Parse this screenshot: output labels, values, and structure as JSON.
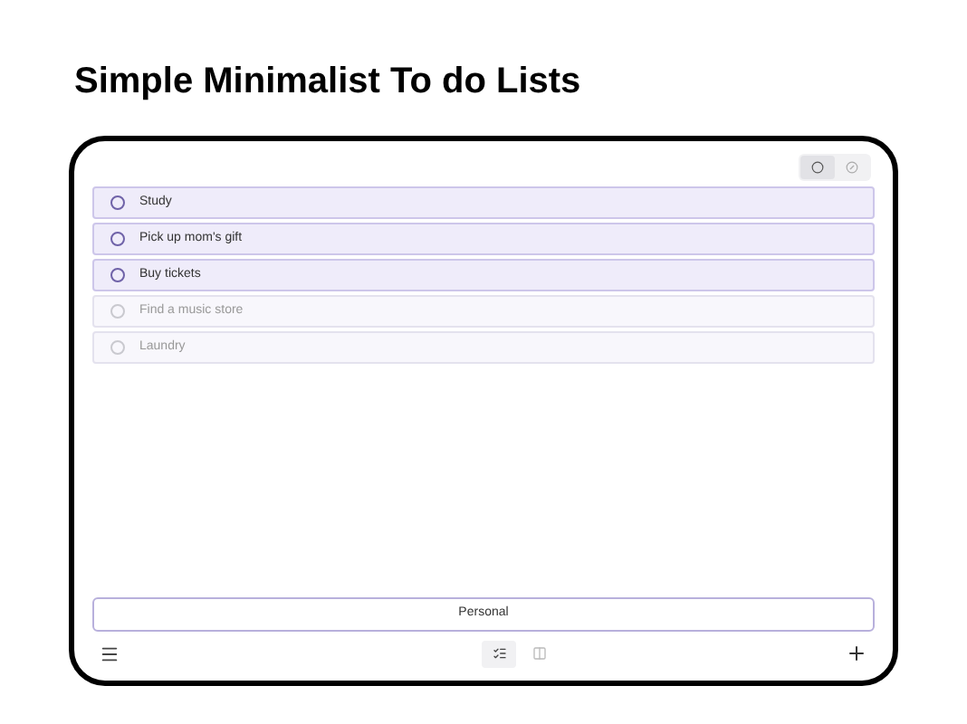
{
  "heading": "Simple Minimalist To do Lists",
  "filter_toggle": [
    {
      "kind": "open",
      "selected": true
    },
    {
      "kind": "done",
      "selected": false
    }
  ],
  "tasks": [
    {
      "text": "Study",
      "dimmed": false
    },
    {
      "text": "Pick up mom's gift",
      "dimmed": false
    },
    {
      "text": "Buy tickets",
      "dimmed": false
    },
    {
      "text": "Find a music store",
      "dimmed": true
    },
    {
      "text": "Laundry",
      "dimmed": true
    }
  ],
  "list_name": "Personal",
  "view_toggle": [
    {
      "kind": "list",
      "selected": true
    },
    {
      "kind": "columns",
      "selected": false
    }
  ]
}
